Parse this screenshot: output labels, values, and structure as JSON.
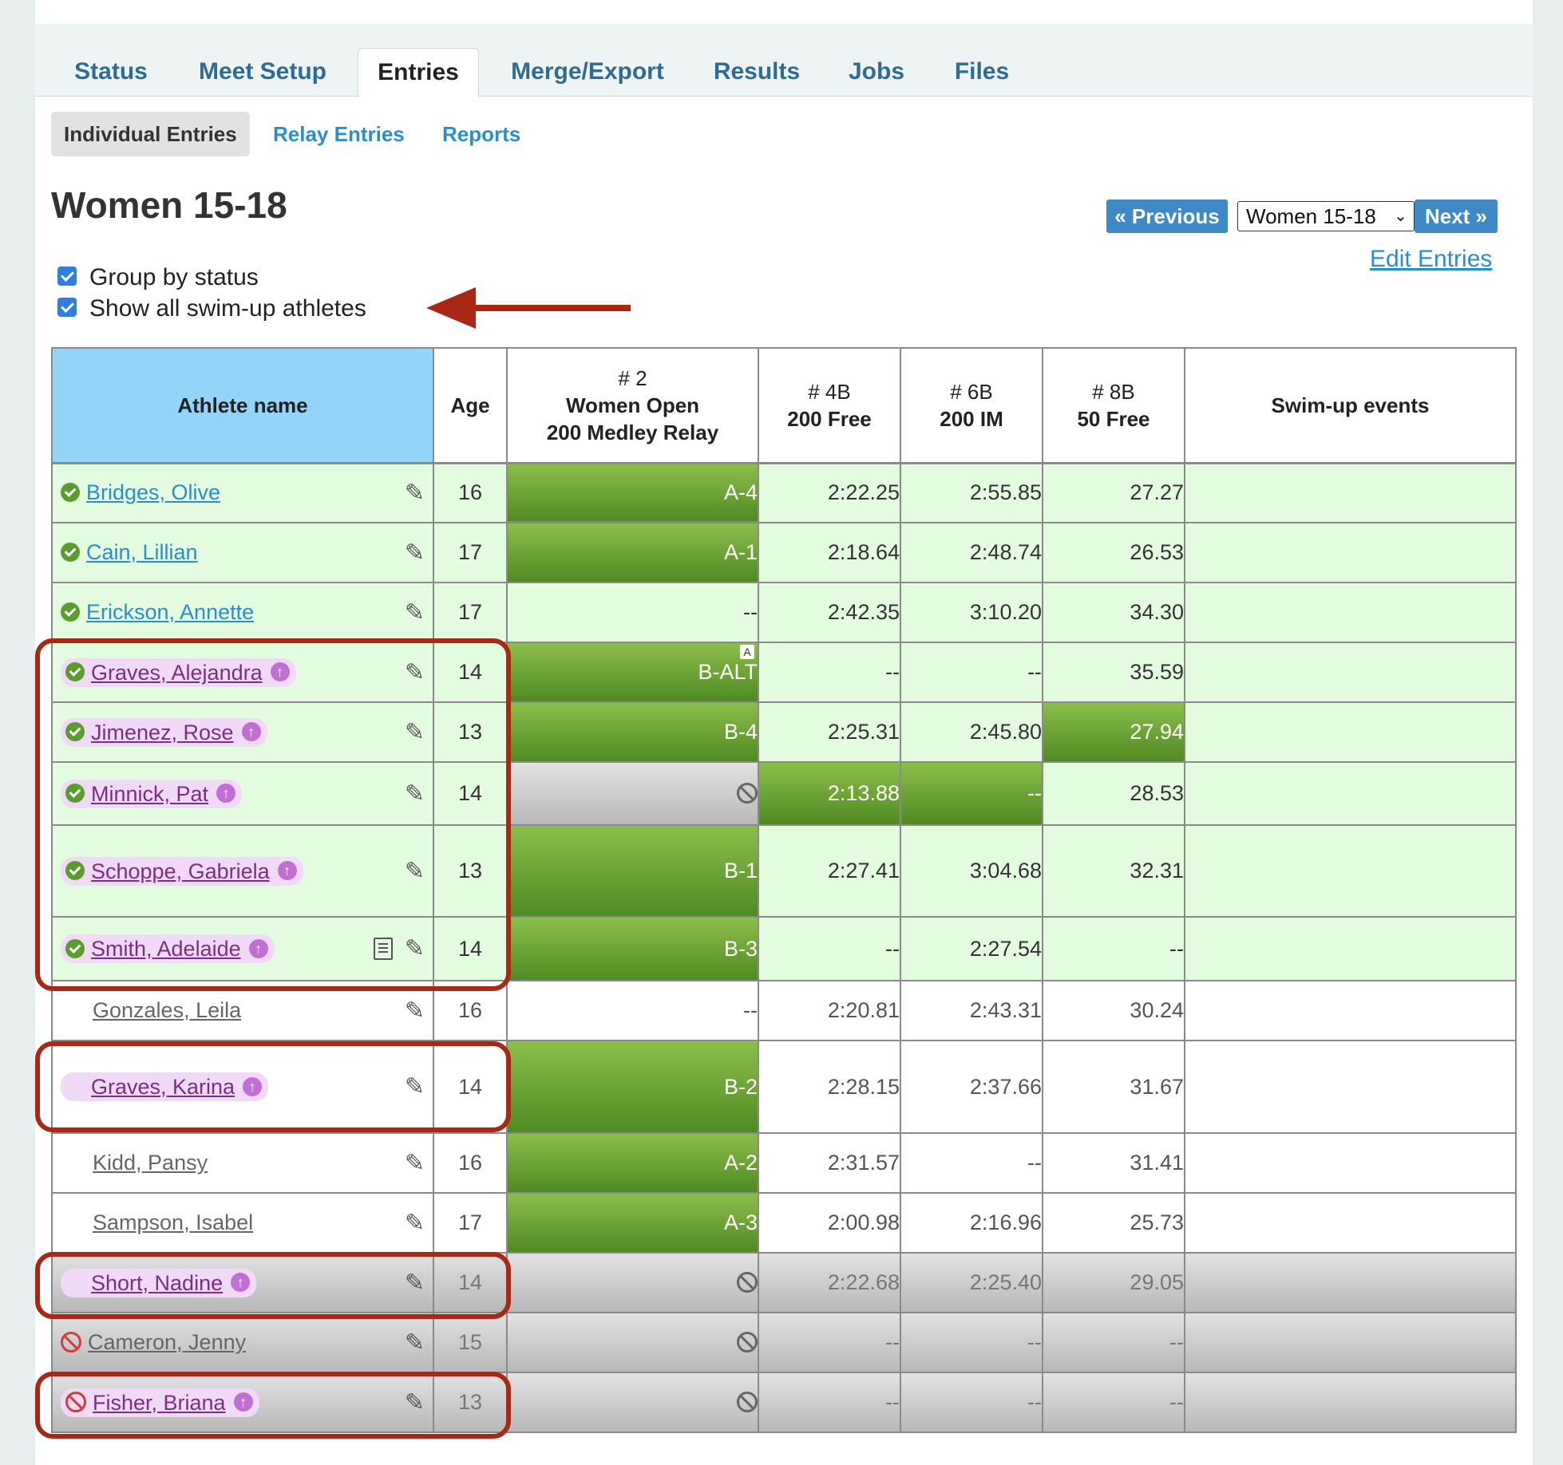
{
  "tabs": [
    "Status",
    "Meet Setup",
    "Entries",
    "Merge/Export",
    "Results",
    "Jobs",
    "Files"
  ],
  "subtabs": [
    "Individual Entries",
    "Relay Entries",
    "Reports"
  ],
  "page_title": "Women 15-18",
  "nav": {
    "previous_label": "« Previous",
    "next_label": "Next »",
    "group_select": "Women 15-18",
    "edit_entries": "Edit Entries"
  },
  "options": {
    "group_by_status": "Group by status",
    "show_swimup": "Show all swim-up athletes"
  },
  "table": {
    "headers": {
      "athlete": "Athlete name",
      "age": "Age",
      "ev2_num": "# 2",
      "ev2_name1": "Women Open",
      "ev2_name2": "200 Medley Relay",
      "ev4_num": "# 4B",
      "ev4_name": "200 Free",
      "ev6_num": "# 6B",
      "ev6_name": "200 IM",
      "ev8_num": "# 8B",
      "ev8_name": "50 Free",
      "swimup": "Swim-up events"
    },
    "rows": [
      {
        "name": "Bridges, Olive",
        "age": "16",
        "relay": "A-4",
        "e4": "2:22.25",
        "e6": "2:55.85",
        "e8": "27.27",
        "swimup": ""
      },
      {
        "name": "Cain, Lillian",
        "age": "17",
        "relay": "A-1",
        "e4": "2:18.64",
        "e6": "2:48.74",
        "e8": "26.53",
        "swimup": ""
      },
      {
        "name": "Erickson, Annette",
        "age": "17",
        "relay": "--",
        "e4": "2:42.35",
        "e6": "3:10.20",
        "e8": "34.30",
        "swimup": ""
      },
      {
        "name": "Graves, Alejandra",
        "age": "14",
        "relay": "B-ALT",
        "relay_badge": "A",
        "e4": "--",
        "e6": "--",
        "e8": "35.59",
        "swimup": ""
      },
      {
        "name": "Jimenez, Rose",
        "age": "13",
        "relay": "B-4",
        "e4": "2:25.31",
        "e6": "2:45.80",
        "e8": "27.94",
        "swimup": ""
      },
      {
        "name": "Minnick, Pat",
        "age": "14",
        "relay": "",
        "e4": "2:13.88",
        "e6": "--",
        "e8": "28.53",
        "swimup": ""
      },
      {
        "name": "Schoppe, Gabriela",
        "age": "13",
        "relay": "B-1",
        "e4": "2:27.41",
        "e6": "3:04.68",
        "e8": "32.31",
        "swimup": ""
      },
      {
        "name": "Smith, Adelaide",
        "age": "14",
        "relay": "B-3",
        "e4": "--",
        "e6": "2:27.54",
        "e8": "--",
        "swimup": ""
      },
      {
        "name": "Gonzales, Leila",
        "age": "16",
        "relay": "--",
        "e4": "2:20.81",
        "e6": "2:43.31",
        "e8": "30.24",
        "swimup": ""
      },
      {
        "name": "Graves, Karina",
        "age": "14",
        "relay": "B-2",
        "e4": "2:28.15",
        "e6": "2:37.66",
        "e8": "31.67",
        "swimup": ""
      },
      {
        "name": "Kidd, Pansy",
        "age": "16",
        "relay": "A-2",
        "e4": "2:31.57",
        "e6": "--",
        "e8": "31.41",
        "swimup": ""
      },
      {
        "name": "Sampson, Isabel",
        "age": "17",
        "relay": "A-3",
        "e4": "2:00.98",
        "e6": "2:16.96",
        "e8": "25.73",
        "swimup": ""
      },
      {
        "name": "Short, Nadine",
        "age": "14",
        "relay": "",
        "e4": "2:22.68",
        "e6": "2:25.40",
        "e8": "29.05",
        "swimup": ""
      },
      {
        "name": "Cameron, Jenny",
        "age": "15",
        "relay": "",
        "e4": "--",
        "e6": "--",
        "e8": "--",
        "swimup": ""
      },
      {
        "name": "Fisher, Briana",
        "age": "13",
        "relay": "",
        "e4": "--",
        "e6": "--",
        "e8": "--",
        "swimup": ""
      }
    ]
  },
  "colors": {
    "accent": "#2a8fc9",
    "header_blue": "#93d5f8",
    "entered_green": "#e3fce0",
    "highlight_green": "#6ea83a",
    "swimup_pill": "#f1d9f8",
    "annotation_red": "#a82815"
  },
  "icons": [
    "check-icon",
    "swim-up-icon",
    "pencil-icon",
    "note-icon",
    "scratch-icon"
  ]
}
